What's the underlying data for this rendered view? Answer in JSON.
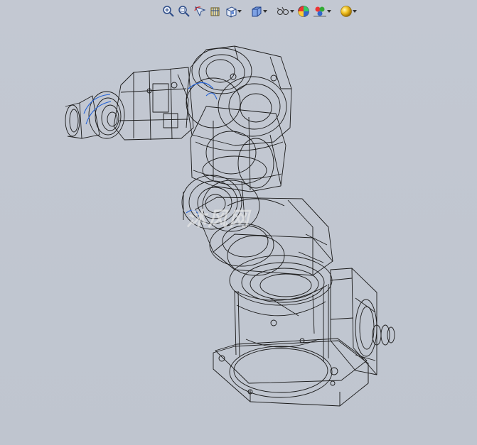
{
  "toolbar": {
    "buttons": [
      {
        "name": "zoom-to-fit-icon"
      },
      {
        "name": "zoom-to-area-icon"
      },
      {
        "name": "previous-view-icon"
      },
      {
        "name": "section-view-icon"
      },
      {
        "name": "view-orientation-icon",
        "dropdown": true
      },
      {
        "name": "display-style-icon",
        "dropdown": true
      },
      {
        "name": "hide-show-items-icon",
        "dropdown": true
      },
      {
        "name": "edit-appearance-icon"
      },
      {
        "name": "apply-scene-icon",
        "dropdown": true
      },
      {
        "name": "view-settings-icon",
        "dropdown": true
      }
    ]
  },
  "watermark": {
    "text": "沐风网"
  },
  "colors": {
    "background": "#c3c8d2",
    "wire": "#1a1a1a",
    "highlight": "#1f5fd6"
  }
}
